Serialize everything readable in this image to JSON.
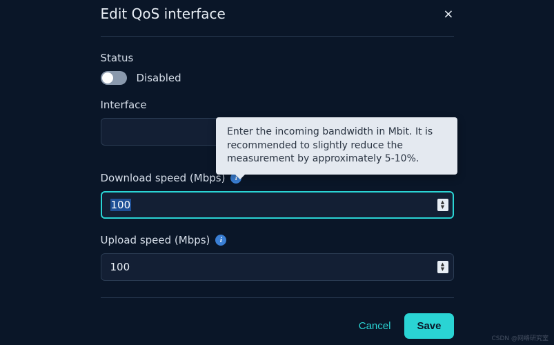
{
  "dialog": {
    "title": "Edit QoS interface",
    "close_label": "×"
  },
  "status": {
    "label": "Status",
    "value": "Disabled"
  },
  "interface": {
    "label": "Interface",
    "selected": ""
  },
  "download": {
    "label": "Download speed (Mbps)",
    "value": "100",
    "tooltip": "Enter the incoming bandwidth in Mbit. It is recommended to slightly reduce the measurement by approximately 5-10%."
  },
  "upload": {
    "label": "Upload speed (Mbps)",
    "value": "100"
  },
  "actions": {
    "cancel": "Cancel",
    "save": "Save"
  },
  "watermark": "CSDN @网络研究室"
}
